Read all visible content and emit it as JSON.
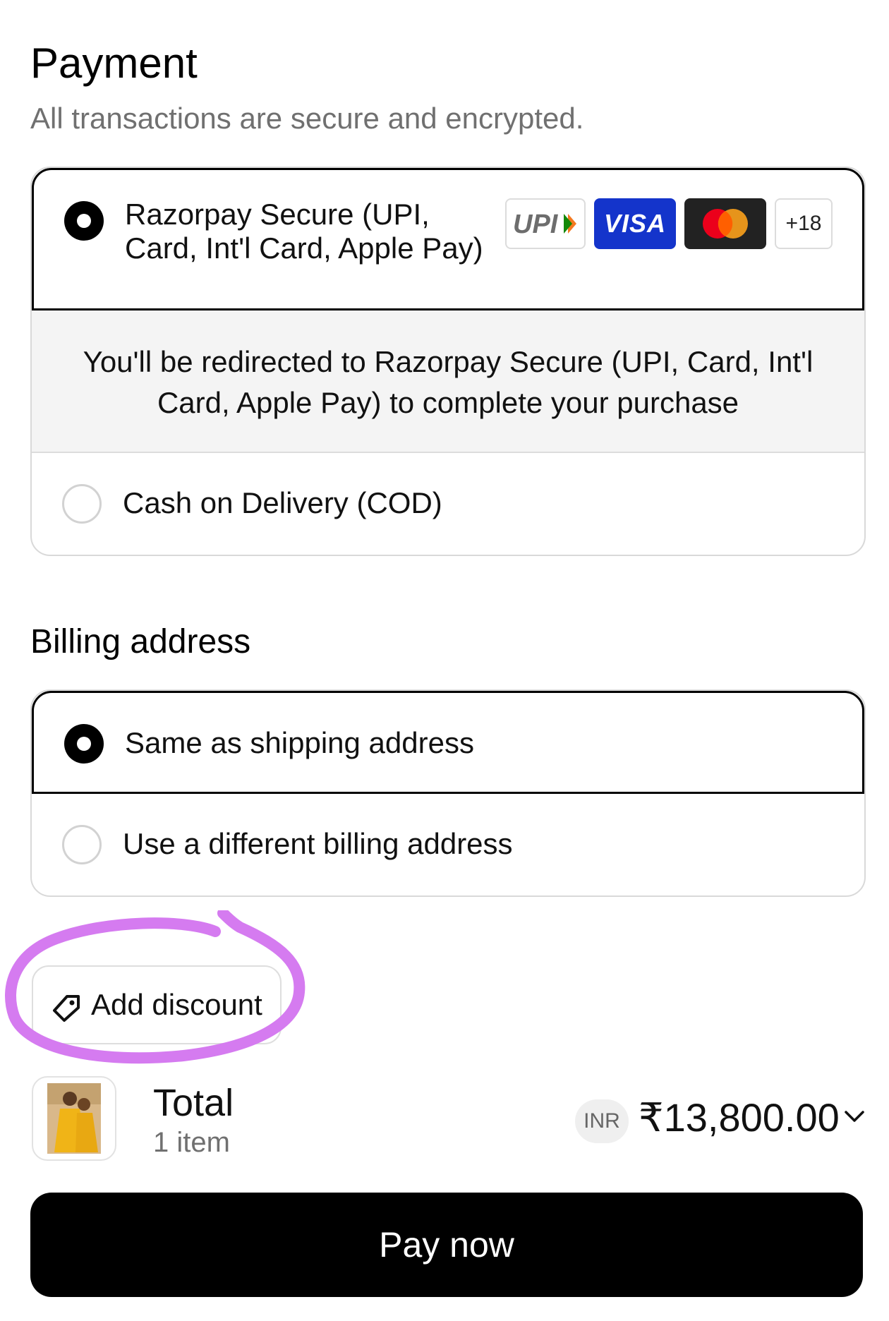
{
  "payment": {
    "title": "Payment",
    "subtitle": "All transactions are secure and encrypted.",
    "options": [
      {
        "label_line1": "Razorpay Secure (UPI,",
        "label_line2": "Card, Int'l Card, Apple Pay)",
        "selected": true
      },
      {
        "label": "Cash on Delivery (COD)",
        "selected": false
      }
    ],
    "badges": {
      "upi": "UPI",
      "visa": "VISA",
      "more": "+18"
    },
    "redirect_line1": "You'll be redirected to Razorpay Secure (UPI, Card, Int'l",
    "redirect_line2": "Card, Apple Pay) to complete your purchase"
  },
  "billing": {
    "title": "Billing address",
    "options": [
      {
        "label": "Same as shipping address",
        "selected": true
      },
      {
        "label": "Use a different billing address",
        "selected": false
      }
    ]
  },
  "discount": {
    "label": "Add discount"
  },
  "summary": {
    "total_label": "Total",
    "items": "1 item",
    "currency": "INR",
    "amount": "₹13,800.00"
  },
  "pay_button": {
    "label": "Pay now"
  },
  "colors": {
    "visa_blue": "#1434cb",
    "mastercard_red": "#eb001b",
    "mastercard_orange": "#f79e1b",
    "annotation_purple": "#d57bf0"
  },
  "icons": [
    "radio-selected",
    "radio-unselected",
    "upi-logo",
    "visa-logo",
    "mastercard-logo",
    "tag-icon",
    "chevron-down-icon"
  ]
}
